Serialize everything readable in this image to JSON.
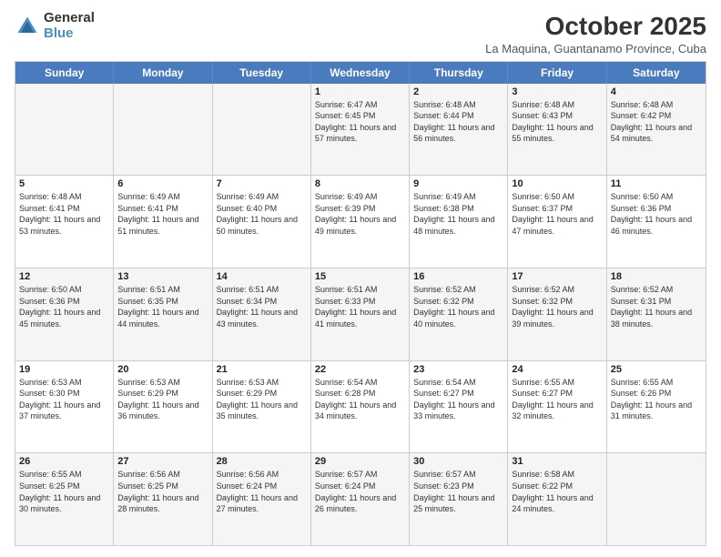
{
  "logo": {
    "general": "General",
    "blue": "Blue"
  },
  "title": "October 2025",
  "subtitle": "La Maquina, Guantanamo Province, Cuba",
  "days": [
    "Sunday",
    "Monday",
    "Tuesday",
    "Wednesday",
    "Thursday",
    "Friday",
    "Saturday"
  ],
  "rows": [
    [
      {
        "day": "",
        "info": ""
      },
      {
        "day": "",
        "info": ""
      },
      {
        "day": "",
        "info": ""
      },
      {
        "day": "1",
        "info": "Sunrise: 6:47 AM\nSunset: 6:45 PM\nDaylight: 11 hours and 57 minutes."
      },
      {
        "day": "2",
        "info": "Sunrise: 6:48 AM\nSunset: 6:44 PM\nDaylight: 11 hours and 56 minutes."
      },
      {
        "day": "3",
        "info": "Sunrise: 6:48 AM\nSunset: 6:43 PM\nDaylight: 11 hours and 55 minutes."
      },
      {
        "day": "4",
        "info": "Sunrise: 6:48 AM\nSunset: 6:42 PM\nDaylight: 11 hours and 54 minutes."
      }
    ],
    [
      {
        "day": "5",
        "info": "Sunrise: 6:48 AM\nSunset: 6:41 PM\nDaylight: 11 hours and 53 minutes."
      },
      {
        "day": "6",
        "info": "Sunrise: 6:49 AM\nSunset: 6:41 PM\nDaylight: 11 hours and 51 minutes."
      },
      {
        "day": "7",
        "info": "Sunrise: 6:49 AM\nSunset: 6:40 PM\nDaylight: 11 hours and 50 minutes."
      },
      {
        "day": "8",
        "info": "Sunrise: 6:49 AM\nSunset: 6:39 PM\nDaylight: 11 hours and 49 minutes."
      },
      {
        "day": "9",
        "info": "Sunrise: 6:49 AM\nSunset: 6:38 PM\nDaylight: 11 hours and 48 minutes."
      },
      {
        "day": "10",
        "info": "Sunrise: 6:50 AM\nSunset: 6:37 PM\nDaylight: 11 hours and 47 minutes."
      },
      {
        "day": "11",
        "info": "Sunrise: 6:50 AM\nSunset: 6:36 PM\nDaylight: 11 hours and 46 minutes."
      }
    ],
    [
      {
        "day": "12",
        "info": "Sunrise: 6:50 AM\nSunset: 6:36 PM\nDaylight: 11 hours and 45 minutes."
      },
      {
        "day": "13",
        "info": "Sunrise: 6:51 AM\nSunset: 6:35 PM\nDaylight: 11 hours and 44 minutes."
      },
      {
        "day": "14",
        "info": "Sunrise: 6:51 AM\nSunset: 6:34 PM\nDaylight: 11 hours and 43 minutes."
      },
      {
        "day": "15",
        "info": "Sunrise: 6:51 AM\nSunset: 6:33 PM\nDaylight: 11 hours and 41 minutes."
      },
      {
        "day": "16",
        "info": "Sunrise: 6:52 AM\nSunset: 6:32 PM\nDaylight: 11 hours and 40 minutes."
      },
      {
        "day": "17",
        "info": "Sunrise: 6:52 AM\nSunset: 6:32 PM\nDaylight: 11 hours and 39 minutes."
      },
      {
        "day": "18",
        "info": "Sunrise: 6:52 AM\nSunset: 6:31 PM\nDaylight: 11 hours and 38 minutes."
      }
    ],
    [
      {
        "day": "19",
        "info": "Sunrise: 6:53 AM\nSunset: 6:30 PM\nDaylight: 11 hours and 37 minutes."
      },
      {
        "day": "20",
        "info": "Sunrise: 6:53 AM\nSunset: 6:29 PM\nDaylight: 11 hours and 36 minutes."
      },
      {
        "day": "21",
        "info": "Sunrise: 6:53 AM\nSunset: 6:29 PM\nDaylight: 11 hours and 35 minutes."
      },
      {
        "day": "22",
        "info": "Sunrise: 6:54 AM\nSunset: 6:28 PM\nDaylight: 11 hours and 34 minutes."
      },
      {
        "day": "23",
        "info": "Sunrise: 6:54 AM\nSunset: 6:27 PM\nDaylight: 11 hours and 33 minutes."
      },
      {
        "day": "24",
        "info": "Sunrise: 6:55 AM\nSunset: 6:27 PM\nDaylight: 11 hours and 32 minutes."
      },
      {
        "day": "25",
        "info": "Sunrise: 6:55 AM\nSunset: 6:26 PM\nDaylight: 11 hours and 31 minutes."
      }
    ],
    [
      {
        "day": "26",
        "info": "Sunrise: 6:55 AM\nSunset: 6:25 PM\nDaylight: 11 hours and 30 minutes."
      },
      {
        "day": "27",
        "info": "Sunrise: 6:56 AM\nSunset: 6:25 PM\nDaylight: 11 hours and 28 minutes."
      },
      {
        "day": "28",
        "info": "Sunrise: 6:56 AM\nSunset: 6:24 PM\nDaylight: 11 hours and 27 minutes."
      },
      {
        "day": "29",
        "info": "Sunrise: 6:57 AM\nSunset: 6:24 PM\nDaylight: 11 hours and 26 minutes."
      },
      {
        "day": "30",
        "info": "Sunrise: 6:57 AM\nSunset: 6:23 PM\nDaylight: 11 hours and 25 minutes."
      },
      {
        "day": "31",
        "info": "Sunrise: 6:58 AM\nSunset: 6:22 PM\nDaylight: 11 hours and 24 minutes."
      },
      {
        "day": "",
        "info": ""
      }
    ]
  ],
  "alt_rows": [
    0,
    2,
    4
  ]
}
